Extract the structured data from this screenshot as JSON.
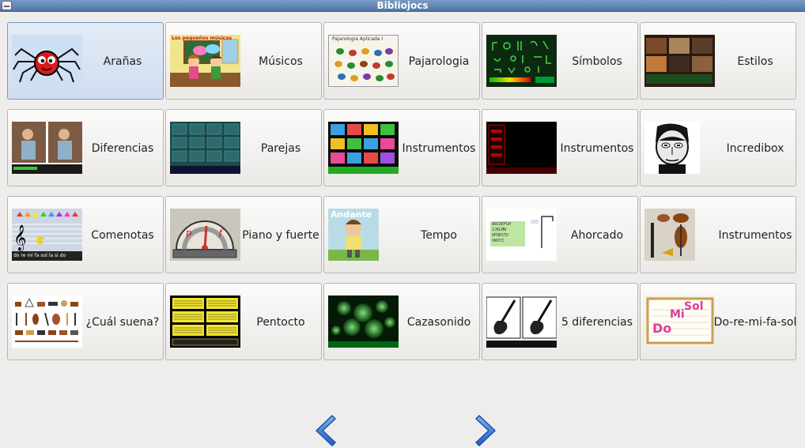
{
  "window": {
    "title": "Bibliojocs"
  },
  "tiles": [
    {
      "label": "Arañas",
      "icon": "spider-thumbnail"
    },
    {
      "label": "Músicos",
      "icon": "musicians-thumbnail"
    },
    {
      "label": "Pajarologia",
      "icon": "birds-thumbnail"
    },
    {
      "label": "Símbolos",
      "icon": "symbols-thumbnail"
    },
    {
      "label": "Estilos",
      "icon": "styles-thumbnail"
    },
    {
      "label": "Diferencias",
      "icon": "differences-thumbnail"
    },
    {
      "label": "Parejas",
      "icon": "pairs-thumbnail"
    },
    {
      "label": "Instrumentos",
      "icon": "instruments-grid-thumbnail"
    },
    {
      "label": "Instrumentos",
      "icon": "instruments-dark-thumbnail"
    },
    {
      "label": "Incredibox",
      "icon": "incredibox-thumbnail"
    },
    {
      "label": "Comenotas",
      "icon": "note-eater-thumbnail"
    },
    {
      "label": "Piano y fuerte",
      "icon": "dynamics-gauge-thumbnail"
    },
    {
      "label": "Tempo",
      "icon": "tempo-character-thumbnail"
    },
    {
      "label": "Ahorcado",
      "icon": "hangman-thumbnail"
    },
    {
      "label": "Instrumentos",
      "icon": "orchestra-instruments-thumbnail"
    },
    {
      "label": "¿Cuál suena?",
      "icon": "which-sounds-thumbnail"
    },
    {
      "label": "Pentocto",
      "icon": "staff-cards-thumbnail"
    },
    {
      "label": "Cazasonido",
      "icon": "sound-hunt-thumbnail"
    },
    {
      "label": "5 diferencias",
      "icon": "guitars-thumbnail"
    },
    {
      "label": "Do-re-mi-fa-sol",
      "icon": "solfege-thumbnail"
    }
  ],
  "thumb_text": {
    "musicos": "Los pequeños músicos",
    "pajaro": "Pajarologia Aplicada I",
    "andante": "Andante",
    "ahorc_letters": [
      "ABCDEFGH",
      "IJKLMN",
      "OPQRSTU",
      "VWXYZ"
    ],
    "comen_notes": "do re mi fa sol la si do",
    "doremi": [
      "Do",
      "Mi",
      "Sol"
    ]
  },
  "navigation": {
    "prev_icon": "arrow-left-icon",
    "next_icon": "arrow-right-icon"
  },
  "colors": {
    "titlebar": "#5b7fb0",
    "arrow": "#2f6fd0"
  }
}
